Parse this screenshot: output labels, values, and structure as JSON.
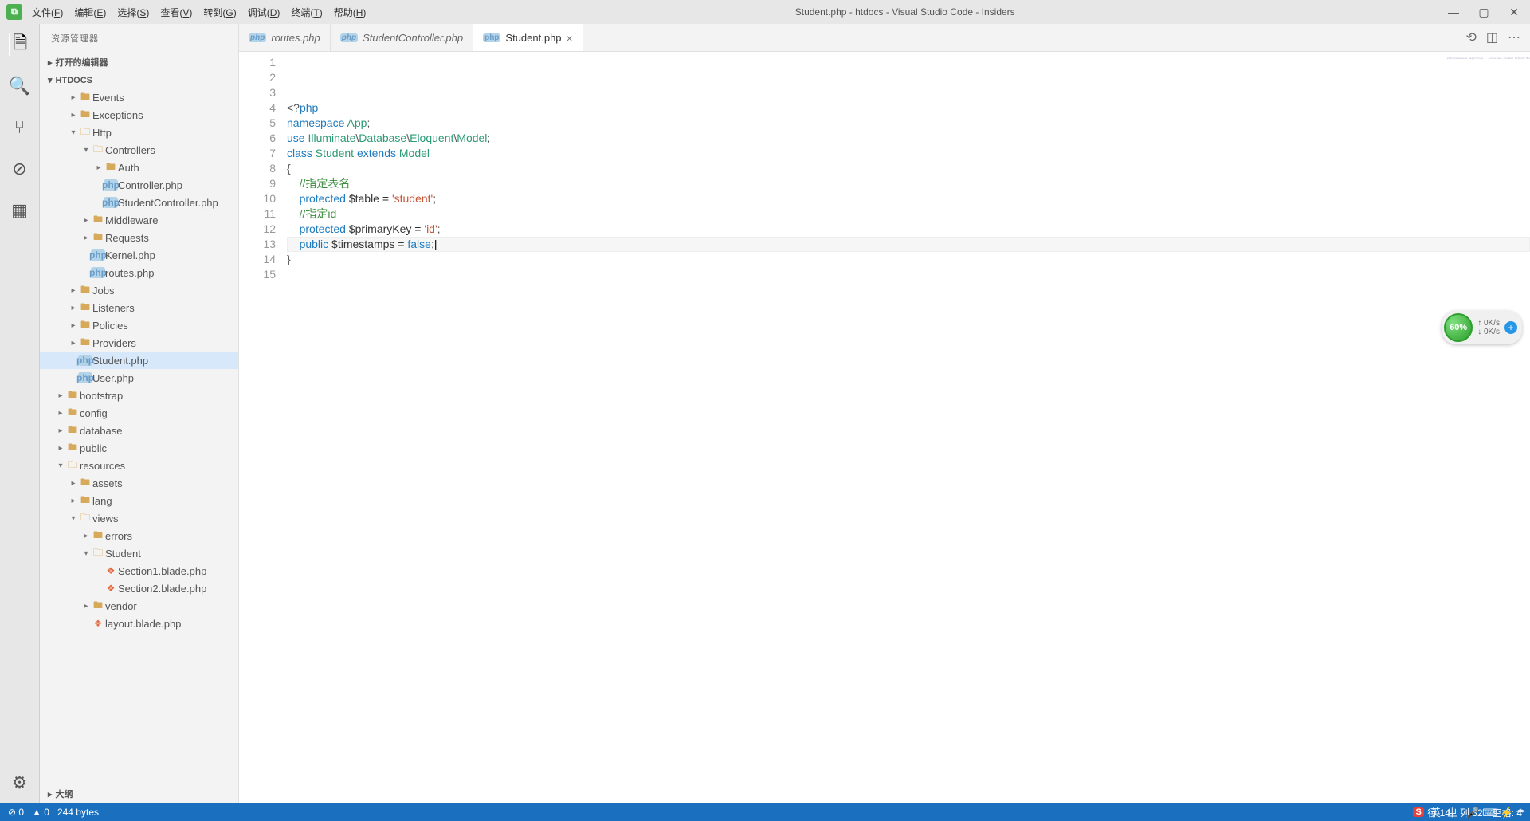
{
  "window": {
    "title": "Student.php - htdocs - Visual Studio Code - Insiders"
  },
  "menu": [
    "文件(F)",
    "编辑(E)",
    "选择(S)",
    "查看(V)",
    "转到(G)",
    "调试(D)",
    "终端(T)",
    "帮助(H)"
  ],
  "sidebar": {
    "title": "资源管理器",
    "open_editors": "打开的编辑器",
    "project": "HTDOCS",
    "outline": "大纲",
    "tree": [
      {
        "d": 1,
        "t": "f",
        "n": "Events",
        "c": true
      },
      {
        "d": 1,
        "t": "f",
        "n": "Exceptions",
        "c": true
      },
      {
        "d": 1,
        "t": "fo",
        "n": "Http",
        "c": false
      },
      {
        "d": 2,
        "t": "fo",
        "n": "Controllers",
        "c": false
      },
      {
        "d": 3,
        "t": "f",
        "n": "Auth",
        "c": true
      },
      {
        "d": 3,
        "t": "php",
        "n": "Controller.php"
      },
      {
        "d": 3,
        "t": "php",
        "n": "StudentController.php"
      },
      {
        "d": 2,
        "t": "f",
        "n": "Middleware",
        "c": true
      },
      {
        "d": 2,
        "t": "f",
        "n": "Requests",
        "c": true
      },
      {
        "d": 2,
        "t": "php",
        "n": "Kernel.php"
      },
      {
        "d": 2,
        "t": "php",
        "n": "routes.php"
      },
      {
        "d": 1,
        "t": "f",
        "n": "Jobs",
        "c": true
      },
      {
        "d": 1,
        "t": "f",
        "n": "Listeners",
        "c": true
      },
      {
        "d": 1,
        "t": "f",
        "n": "Policies",
        "c": true
      },
      {
        "d": 1,
        "t": "f",
        "n": "Providers",
        "c": true
      },
      {
        "d": 1,
        "t": "php",
        "n": "Student.php",
        "sel": true
      },
      {
        "d": 1,
        "t": "php",
        "n": "User.php"
      },
      {
        "d": 0,
        "t": "f",
        "n": "bootstrap",
        "c": true
      },
      {
        "d": 0,
        "t": "f",
        "n": "config",
        "c": true
      },
      {
        "d": 0,
        "t": "f",
        "n": "database",
        "c": true
      },
      {
        "d": 0,
        "t": "f",
        "n": "public",
        "c": true
      },
      {
        "d": 0,
        "t": "fo",
        "n": "resources",
        "c": false
      },
      {
        "d": 1,
        "t": "f",
        "n": "assets",
        "c": true
      },
      {
        "d": 1,
        "t": "f",
        "n": "lang",
        "c": true
      },
      {
        "d": 1,
        "t": "fo",
        "n": "views",
        "c": false
      },
      {
        "d": 2,
        "t": "f",
        "n": "errors",
        "c": true
      },
      {
        "d": 2,
        "t": "fo",
        "n": "Student",
        "c": false
      },
      {
        "d": 3,
        "t": "blade",
        "n": "Section1.blade.php"
      },
      {
        "d": 3,
        "t": "blade",
        "n": "Section2.blade.php"
      },
      {
        "d": 2,
        "t": "f",
        "n": "vendor",
        "c": true
      },
      {
        "d": 2,
        "t": "blade",
        "n": "layout.blade.php"
      }
    ]
  },
  "tabs": [
    {
      "label": "routes.php",
      "active": false,
      "close": false
    },
    {
      "label": "StudentController.php",
      "active": false,
      "close": false
    },
    {
      "label": "Student.php",
      "active": true,
      "close": true
    }
  ],
  "code": {
    "lines": [
      {
        "n": 1,
        "seg": [
          [
            "op",
            "<?"
          ],
          [
            "kw",
            "php"
          ]
        ]
      },
      {
        "n": 2,
        "seg": [
          [
            "kw",
            "namespace"
          ],
          [
            "",
            " "
          ],
          [
            "cls",
            "App"
          ],
          [
            "op",
            ";"
          ]
        ]
      },
      {
        "n": 3,
        "seg": [
          [
            "",
            ""
          ]
        ]
      },
      {
        "n": 4,
        "seg": [
          [
            "kw",
            "use"
          ],
          [
            "",
            " "
          ],
          [
            "cls",
            "Illuminate"
          ],
          [
            "op",
            "\\"
          ],
          [
            "cls",
            "Database"
          ],
          [
            "op",
            "\\"
          ],
          [
            "cls",
            "Eloquent"
          ],
          [
            "op",
            "\\"
          ],
          [
            "cls",
            "Model"
          ],
          [
            "op",
            ";"
          ]
        ]
      },
      {
        "n": 5,
        "seg": [
          [
            "",
            ""
          ]
        ]
      },
      {
        "n": 6,
        "seg": [
          [
            "kw",
            "class"
          ],
          [
            "",
            " "
          ],
          [
            "cls",
            "Student"
          ],
          [
            "",
            " "
          ],
          [
            "kw",
            "extends"
          ],
          [
            "",
            " "
          ],
          [
            "cls",
            "Model"
          ]
        ]
      },
      {
        "n": 7,
        "seg": [
          [
            "op",
            "{"
          ]
        ]
      },
      {
        "n": 8,
        "seg": [
          [
            "",
            "    "
          ],
          [
            "cmt",
            "//指定表名"
          ]
        ]
      },
      {
        "n": 9,
        "seg": [
          [
            "",
            "    "
          ],
          [
            "kw",
            "protected"
          ],
          [
            "",
            " "
          ],
          [
            "",
            "$table"
          ],
          [
            "",
            " = "
          ],
          [
            "str",
            "'student'"
          ],
          [
            "op",
            ";"
          ]
        ]
      },
      {
        "n": 10,
        "seg": [
          [
            "",
            ""
          ]
        ]
      },
      {
        "n": 11,
        "seg": [
          [
            "",
            "    "
          ],
          [
            "cmt",
            "//指定id"
          ]
        ]
      },
      {
        "n": 12,
        "seg": [
          [
            "",
            "    "
          ],
          [
            "kw",
            "protected"
          ],
          [
            "",
            " "
          ],
          [
            "",
            "$primaryKey"
          ],
          [
            "",
            " = "
          ],
          [
            "str",
            "'id'"
          ],
          [
            "op",
            ";"
          ]
        ]
      },
      {
        "n": 13,
        "seg": [
          [
            "",
            ""
          ]
        ]
      },
      {
        "n": 14,
        "cur": true,
        "seg": [
          [
            "",
            "    "
          ],
          [
            "kw",
            "public"
          ],
          [
            "",
            " "
          ],
          [
            "",
            "$timestamps"
          ],
          [
            "",
            " = "
          ],
          [
            "const",
            "false"
          ],
          [
            "op",
            ";"
          ]
        ]
      },
      {
        "n": 15,
        "seg": [
          [
            "op",
            "}"
          ]
        ]
      }
    ]
  },
  "status": {
    "errors": "⊘ 0",
    "warnings": "▲ 0",
    "bytes": "244 bytes",
    "pos": "行 14，列 32",
    "spaces": "空格: 4",
    "ime_label": "S",
    "lang": "英",
    "extra": "ㄓ · 🎤 ⌨ ⚡ ☂"
  },
  "floater": {
    "pct": "60%",
    "up": "0K/s",
    "down": "0K/s"
  }
}
